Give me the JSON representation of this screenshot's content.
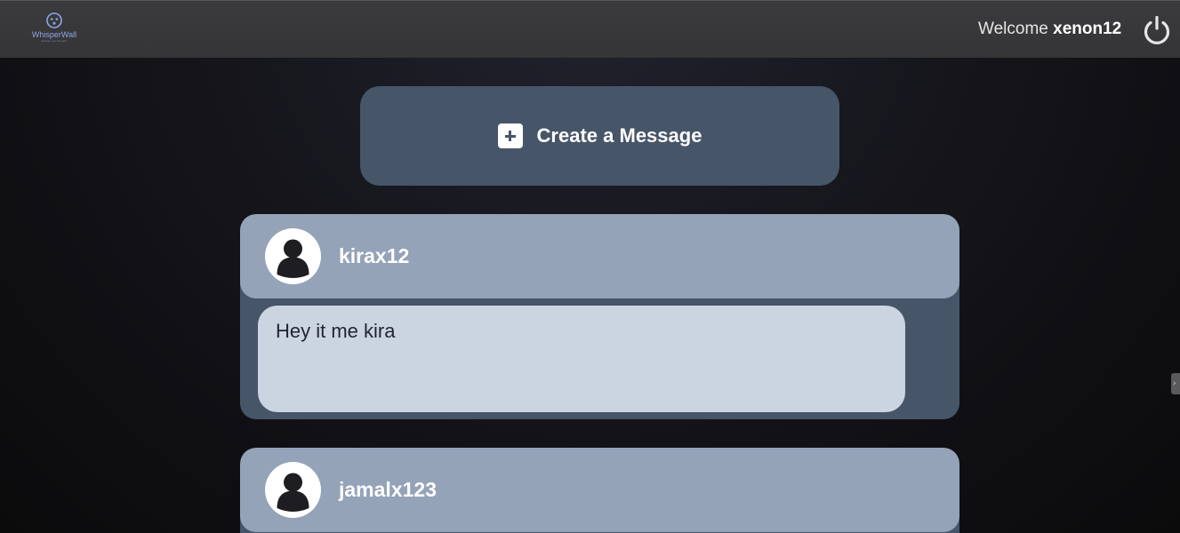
{
  "header": {
    "logo_text": "WhisperWall",
    "logo_tagline": "whisper your thoughts",
    "welcome_prefix": "Welcome",
    "username": "xenon12"
  },
  "create_button": {
    "label": "Create a Message"
  },
  "messages": [
    {
      "author": "kirax12",
      "text": "Hey it me kira"
    },
    {
      "author": "jamalx123",
      "text": ""
    }
  ],
  "colors": {
    "topbar": "#3a3a3c",
    "card_body": "#475569",
    "card_header": "#94a3b8",
    "message_bubble": "#cbd5e1"
  },
  "side_tab_glyph": "›"
}
